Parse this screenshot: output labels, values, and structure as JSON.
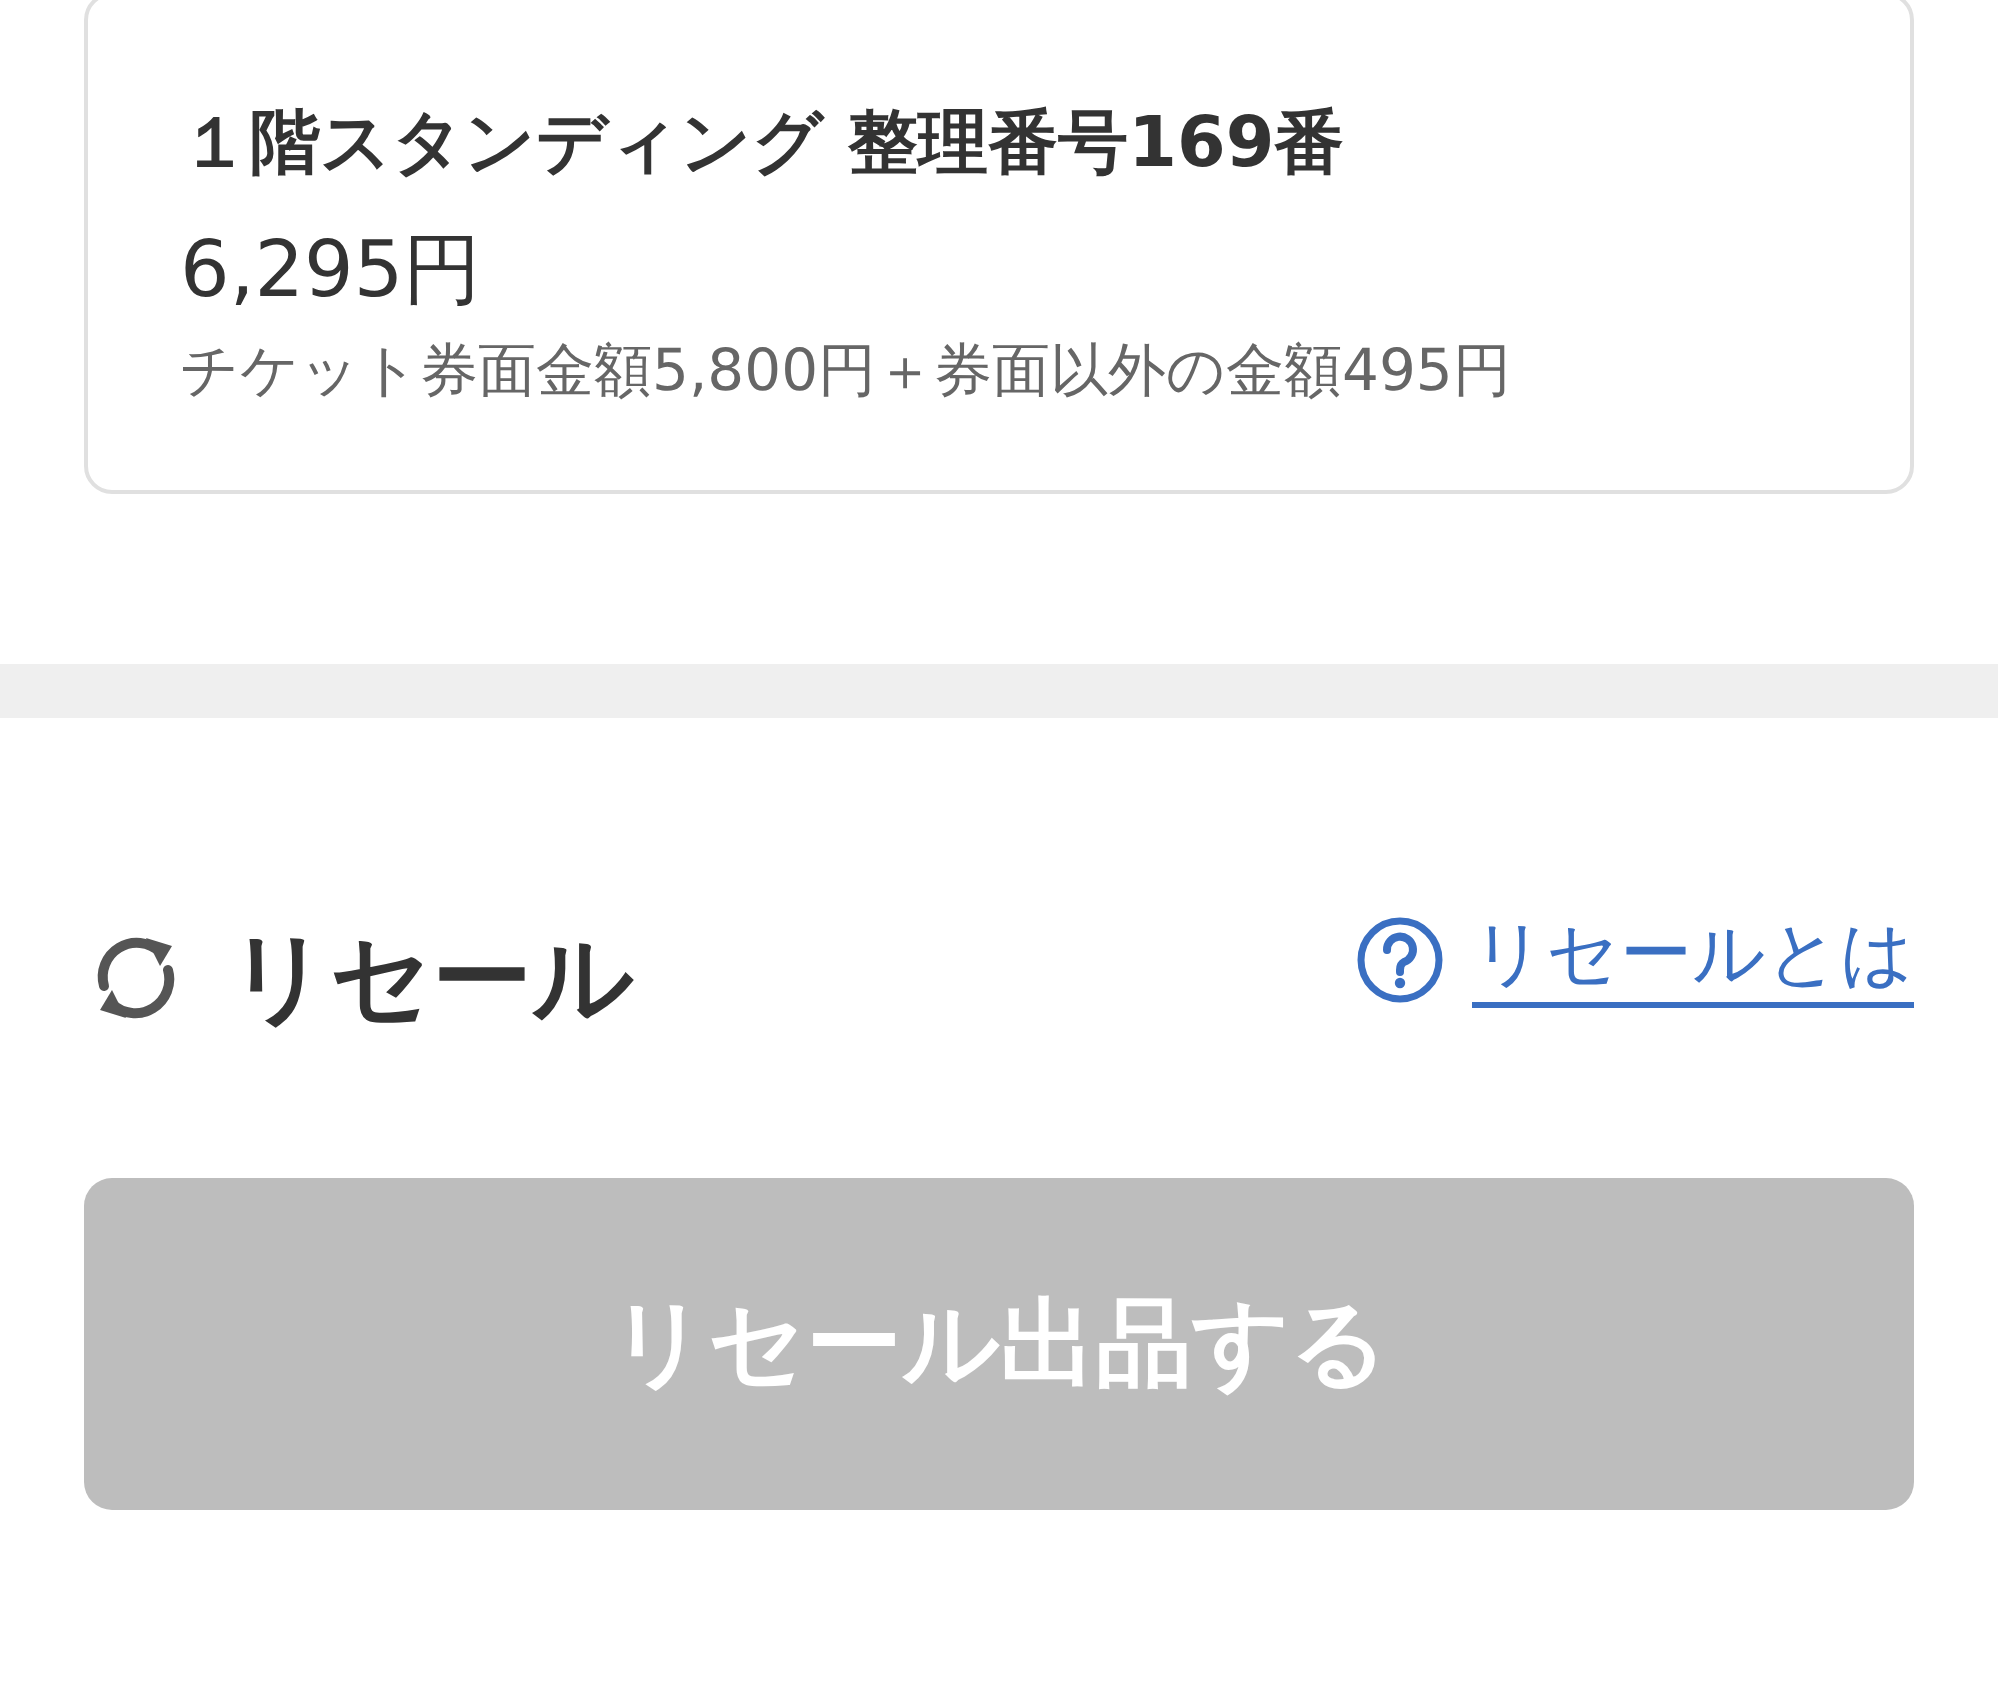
{
  "ticket": {
    "title": "１階スタンディング 整理番号169番",
    "price": "6,295円",
    "breakdown": "チケット券面金額5,800円＋券面以外の金額495円"
  },
  "resale": {
    "heading": "リセール",
    "help_link": "リセールとは",
    "button": {
      "label": "リセール出品する",
      "disabled": true
    }
  }
}
